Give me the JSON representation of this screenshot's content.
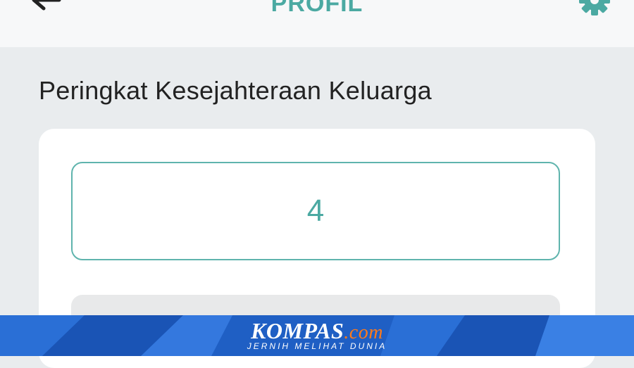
{
  "header": {
    "title": "PROFIL",
    "back_icon": "arrow-left-icon",
    "settings_icon": "gear-icon"
  },
  "section": {
    "heading": "Peringkat Kesejahteraan Keluarga"
  },
  "card": {
    "rank_value": "4"
  },
  "watermark": {
    "brand": "KOMPAS",
    "suffix": ".com",
    "tagline": "JERNIH MELIHAT DUNIA"
  },
  "colors": {
    "accent": "#4ba9a2",
    "background": "#e9ecee",
    "watermark_blue": "#1f5fc4",
    "watermark_orange": "#ff7a1a"
  }
}
